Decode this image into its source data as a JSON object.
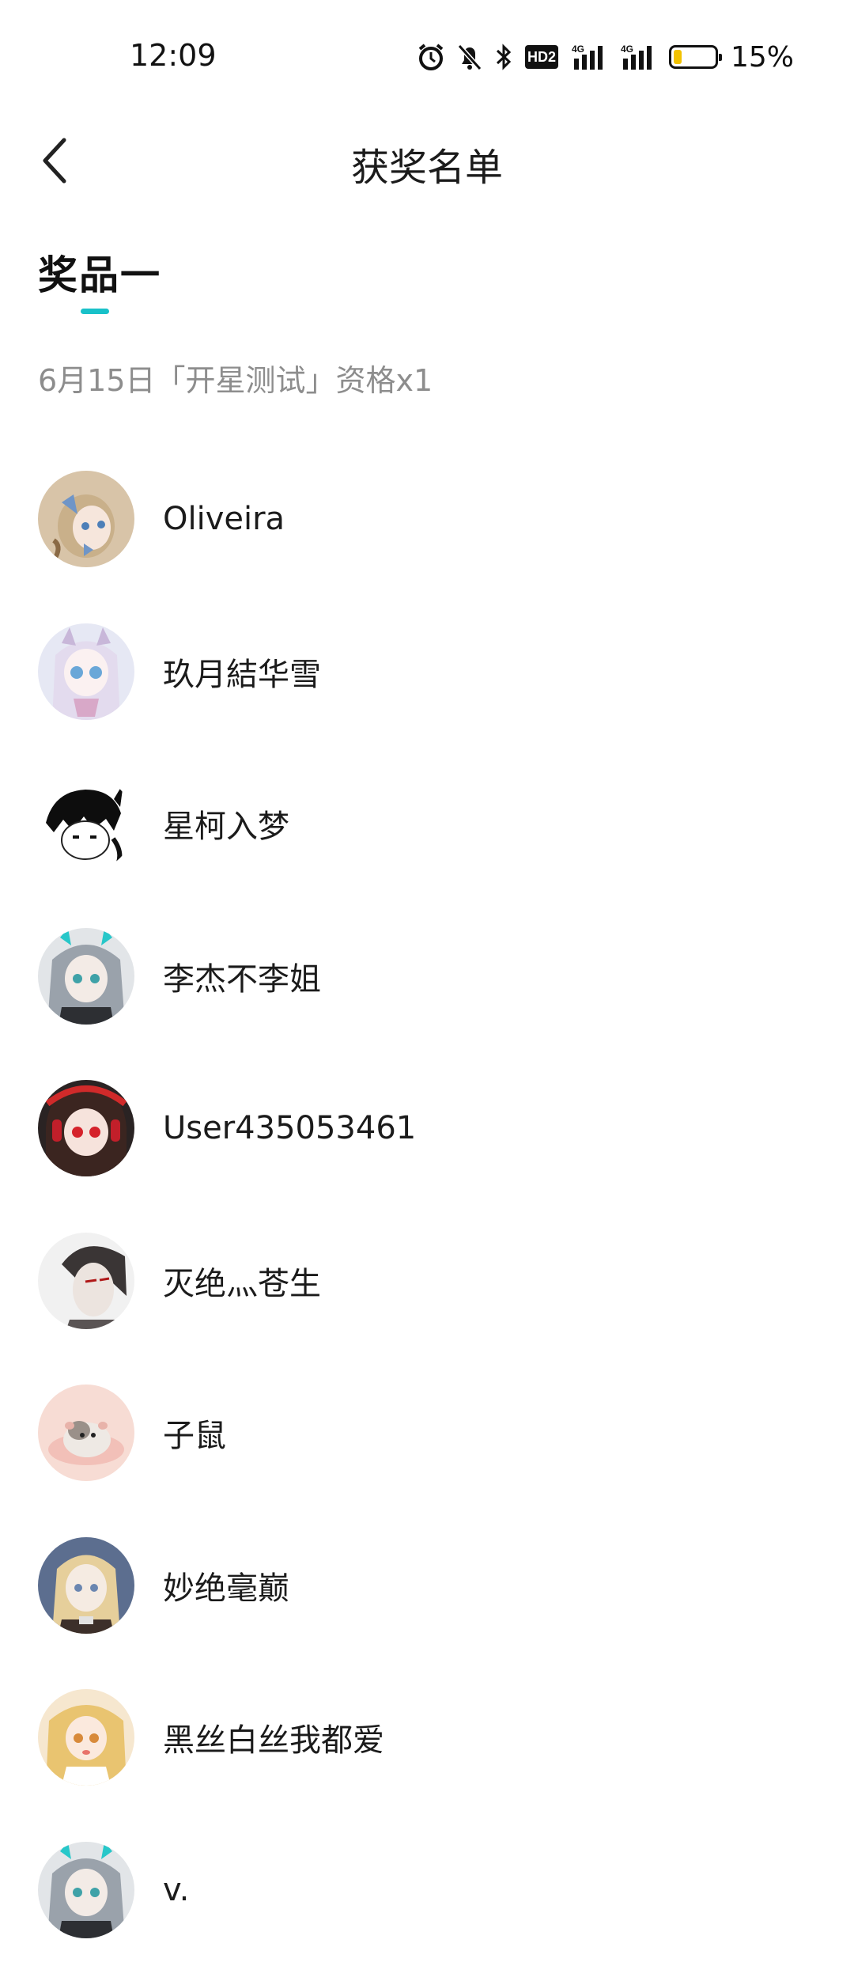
{
  "status_bar": {
    "time": "12:09",
    "battery_percent": "15%",
    "battery_level": 0.15,
    "hd_label": "HD2",
    "icons": [
      "alarm-icon",
      "silent-bell-icon",
      "bluetooth-icon",
      "hd-voice-icon",
      "signal-4g-icon",
      "signal-4g-icon",
      "battery-icon"
    ]
  },
  "nav": {
    "title": "获奖名单",
    "back_icon": "chevron-left-icon"
  },
  "tab": {
    "label": "奖品一",
    "accent": "#19c1c9"
  },
  "prize": {
    "description": "6月15日「开星测试」资格x1"
  },
  "winners": [
    {
      "name": "Oliveira",
      "avatar": "anime-girl-avatar"
    },
    {
      "name": "玖月結华雪",
      "avatar": "anime-girl-avatar"
    },
    {
      "name": "星柯入梦",
      "avatar": "sketch-avatar"
    },
    {
      "name": "李杰不李姐",
      "avatar": "anime-girl-avatar"
    },
    {
      "name": "User435053461",
      "avatar": "anime-girl-avatar"
    },
    {
      "name": "灭绝灬苍生",
      "avatar": "anime-boy-avatar"
    },
    {
      "name": "子鼠",
      "avatar": "hamster-avatar"
    },
    {
      "name": "妙绝毫巅",
      "avatar": "anime-girl-avatar"
    },
    {
      "name": "黑丝白丝我都爱",
      "avatar": "anime-girl-avatar"
    },
    {
      "name": "v.",
      "avatar": "anime-girl-avatar"
    }
  ]
}
